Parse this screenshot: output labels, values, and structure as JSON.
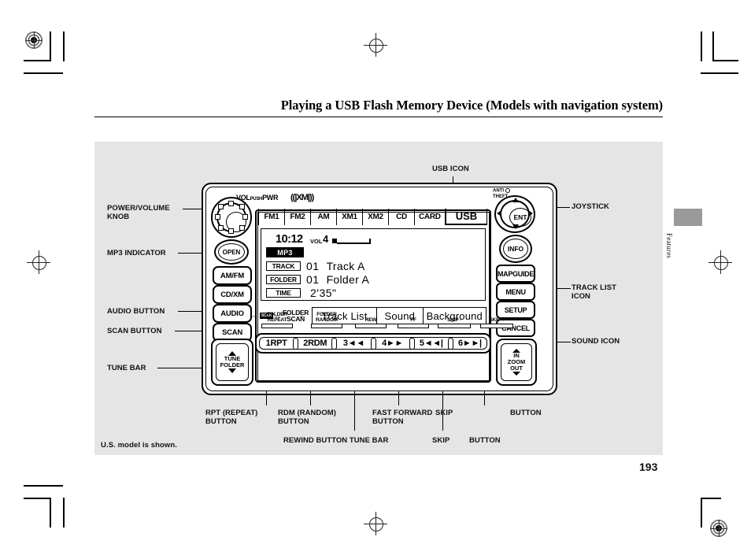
{
  "document": {
    "title": "Playing a USB Flash Memory Device (Models with navigation system)",
    "page_number": "193",
    "footnote": "U.S. model is shown.",
    "side_tab": "Features"
  },
  "radio": {
    "top_labels": {
      "vol": "VOL",
      "push": "PUSH",
      "pwr": "PWR",
      "xm_logo": "((|XM|))",
      "anti_theft_line1": "ANTI",
      "anti_theft_line2": "THEFT"
    },
    "left_buttons": [
      {
        "name": "open",
        "label": "OPEN"
      },
      {
        "name": "am-fm",
        "label": "AM/FM"
      },
      {
        "name": "cd-xm",
        "label": "CD/XM"
      },
      {
        "name": "audio",
        "label": "AUDIO"
      },
      {
        "name": "scan",
        "label": "SCAN"
      }
    ],
    "tune_bar": {
      "line1": "TUNE",
      "line2": "FOLDER"
    },
    "right_buttons": [
      {
        "name": "ent",
        "label": "ENT"
      },
      {
        "name": "info",
        "label": "INFO"
      },
      {
        "name": "map-guide",
        "label": "MAPGUIDE"
      },
      {
        "name": "menu",
        "label": "MENU"
      },
      {
        "name": "setup",
        "label": "SETUP"
      },
      {
        "name": "cancel",
        "label": "CANCEL"
      }
    ],
    "zoom_bar": {
      "line1": "IN",
      "line2": "ZOOM",
      "line3": "OUT"
    },
    "source_tabs": [
      {
        "label": "FM1",
        "selected": false
      },
      {
        "label": "FM2",
        "selected": false
      },
      {
        "label": "AM",
        "selected": false
      },
      {
        "label": "XM1",
        "selected": false
      },
      {
        "label": "XM2",
        "selected": false
      },
      {
        "label": "CD",
        "selected": false
      },
      {
        "label": "CARD",
        "selected": false
      },
      {
        "label": "USB",
        "selected": true
      }
    ],
    "display": {
      "time": "10:12",
      "vol_label": "VOL",
      "vol_value": "4",
      "format_badge": "MP3",
      "rows": [
        {
          "tag": "TRACK",
          "number": "01",
          "text": "Track A"
        },
        {
          "tag": "FOLDER",
          "number": "01",
          "text": "Folder A"
        },
        {
          "tag": "TIME",
          "number": "2'35\"",
          "text": ""
        }
      ],
      "scan_badge": "SCAN",
      "scan_arrow": "↔",
      "folder_scan_line1": "FOLDER",
      "folder_scan_line2": "SCAN",
      "soft_buttons": [
        {
          "label": "Track List"
        },
        {
          "label": "Sound"
        },
        {
          "label": "Background"
        }
      ]
    },
    "preset_hints": [
      {
        "label": "FOLDER\nREPEAT",
        "arrow": "↔"
      },
      {
        "label": "FOLDER\nRANDOM",
        "arrow": "↔"
      },
      {
        "label": "REW",
        "arrow": ""
      },
      {
        "label": "FF",
        "arrow": ""
      },
      {
        "label": "SKIP -",
        "arrow": ""
      },
      {
        "label": "SKIP +",
        "arrow": ""
      }
    ],
    "presets": [
      {
        "label": "1RPT"
      },
      {
        "label": "2RDM"
      },
      {
        "label": "3◄◄"
      },
      {
        "label": "4►►"
      },
      {
        "label": "5◄◄|"
      },
      {
        "label": "6►►|"
      }
    ]
  },
  "callouts": {
    "usb_icon": "USB ICON",
    "power_volume_knob": "POWER/VOLUME\nKNOB",
    "mp3_indicator": "MP3 INDICATOR",
    "audio_button": "AUDIO BUTTON",
    "scan_button": "SCAN BUTTON",
    "tune_bar": "TUNE BAR",
    "joystick": "JOYSTICK",
    "track_list_icon": "TRACK LIST\nICON",
    "sound_icon": "SOUND ICON",
    "rpt_button": "RPT (REPEAT)\nBUTTON",
    "rdm_button": "RDM (RANDOM)\nBUTTON",
    "fast_forward_button": "FAST FORWARD\nBUTTON",
    "skip_top": "SKIP",
    "button_top": "BUTTON",
    "rewind_button_tune_bar": "REWIND BUTTON TUNE BAR",
    "skip_bottom": "SKIP",
    "button_bottom": "BUTTON"
  }
}
